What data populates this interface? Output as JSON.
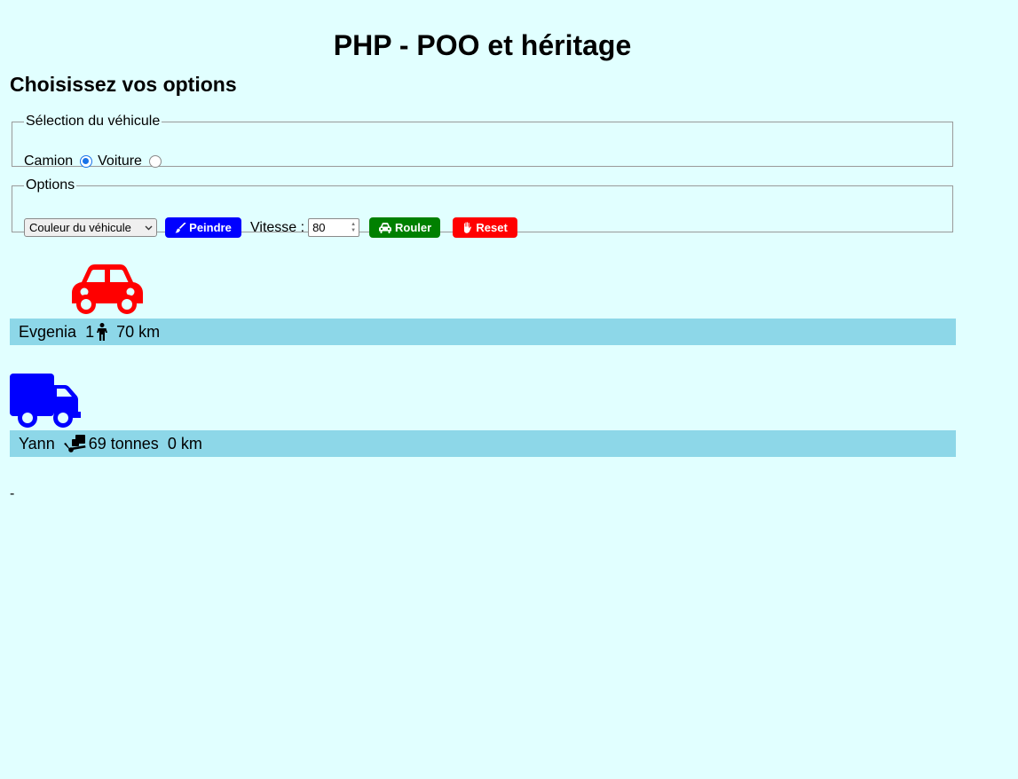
{
  "page": {
    "title": "PHP - POO et héritage",
    "section_title": "Choisissez vos options",
    "footer_text": "-"
  },
  "vehicle_selection": {
    "legend": "Sélection du véhicule",
    "options": [
      {
        "label": "Camion",
        "checked": true
      },
      {
        "label": "Voiture",
        "checked": false
      }
    ]
  },
  "options": {
    "legend": "Options",
    "color_select": {
      "selected": "Couleur du véhicule",
      "icon": "chevron-down-icon"
    },
    "paint_button": {
      "label": "Peindre",
      "icon": "paintbrush-icon",
      "color": "#0000ff"
    },
    "speed_label": "Vitesse :",
    "speed_value": "80",
    "drive_button": {
      "label": "Rouler",
      "icon": "car-icon",
      "color": "#008000"
    },
    "reset_button": {
      "label": "Reset",
      "icon": "hand-icon",
      "color": "#ff0000"
    }
  },
  "vehicles": [
    {
      "type": "car",
      "icon": "car-icon",
      "color": "#ff0000",
      "driver": "Evgenia",
      "passengers": "1",
      "passenger_icon": "person-icon",
      "distance": "70 km"
    },
    {
      "type": "truck",
      "icon": "truck-icon",
      "color": "#0000ff",
      "driver": "Yann",
      "load_icon": "dolly-icon",
      "load": "69 tonnes",
      "distance": "0 km"
    }
  ]
}
